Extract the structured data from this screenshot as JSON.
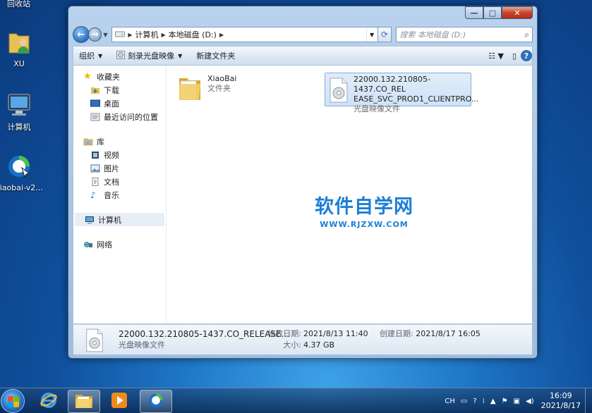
{
  "desktop": {
    "top_label": "回收站",
    "icons": [
      {
        "label": "XU",
        "icon": "user-folder-icon"
      },
      {
        "label": "计算机",
        "icon": "computer-icon"
      },
      {
        "label": "xiaobai-v2...",
        "icon": "xiaobai-app-icon"
      }
    ]
  },
  "window": {
    "caption_buttons": {
      "minimize": "—",
      "maximize": "□",
      "close": "✕"
    },
    "breadcrumb": [
      "计算机",
      "本地磁盘 (D:)"
    ],
    "search_placeholder": "搜索 本地磁盘 (D:)",
    "toolbar": {
      "organize": "组织",
      "burn": "刻录光盘映像",
      "new_folder": "新建文件夹"
    },
    "nav": {
      "favorites": "收藏夹",
      "favorites_items": [
        "下载",
        "桌面",
        "最近访问的位置"
      ],
      "libraries": "库",
      "libraries_items": [
        "视频",
        "图片",
        "文档",
        "音乐"
      ],
      "computer": "计算机",
      "network": "网络"
    },
    "files": [
      {
        "name": "XiaoBai",
        "type": "文件夹",
        "icon": "folder-icon"
      },
      {
        "name_line1": "22000.132.210805-1437.CO_REL",
        "name_line2": "EASE_SVC_PROD1_CLIENTPRO...",
        "type": "光盘映像文件",
        "icon": "disc-image-icon",
        "selected": true
      }
    ],
    "watermark": {
      "title": "软件自学网",
      "url": "WWW.RJZXW.COM"
    },
    "details": {
      "name": "22000.132.210805-1437.CO_RELEASE...",
      "type": "光盘映像文件",
      "modified_label": "修改日期:",
      "modified_value": "2021/8/13 11:40",
      "size_label": "大小:",
      "size_value": "4.37 GB",
      "created_label": "创建日期:",
      "created_value": "2021/8/17 16:05"
    }
  },
  "taskbar": {
    "tray": {
      "lang": "CH",
      "time": "16:09",
      "date": "2021/8/17"
    }
  },
  "colors": {
    "accent": "#1a7fd6",
    "selection": "#cfe2f7"
  }
}
